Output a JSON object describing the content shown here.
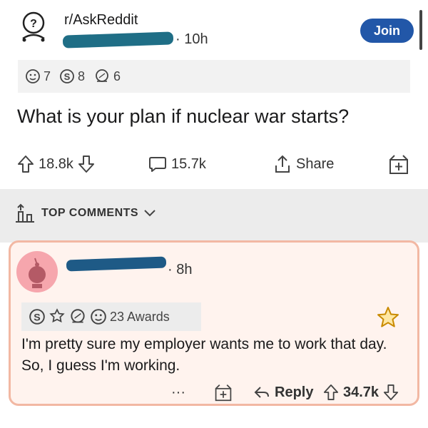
{
  "post": {
    "subreddit": "r/AskReddit",
    "time": "· 10h",
    "join_label": "Join",
    "awards": [
      {
        "icon": "face-award-icon",
        "count": "7"
      },
      {
        "icon": "silver-coin-icon",
        "count": "8"
      },
      {
        "icon": "thinking-award-icon",
        "count": "6"
      }
    ],
    "title": "What is your plan if nuclear war starts?",
    "upvotes": "18.8k",
    "comments": "15.7k",
    "share_label": "Share"
  },
  "section": {
    "sort_label": "TOP COMMENTS"
  },
  "comment": {
    "time": "· 8h",
    "awards_label": "23 Awards",
    "body": "I'm pretty sure my employer wants me to work that day. So, I guess I'm working.",
    "more_label": "···",
    "reply_label": "Reply",
    "upvotes": "34.7k"
  },
  "colors": {
    "join_button": "#2257a8",
    "comment_highlight_bg": "#fff3ee",
    "comment_highlight_border": "#f2b8a3",
    "avatar": "#f6a6ad"
  }
}
